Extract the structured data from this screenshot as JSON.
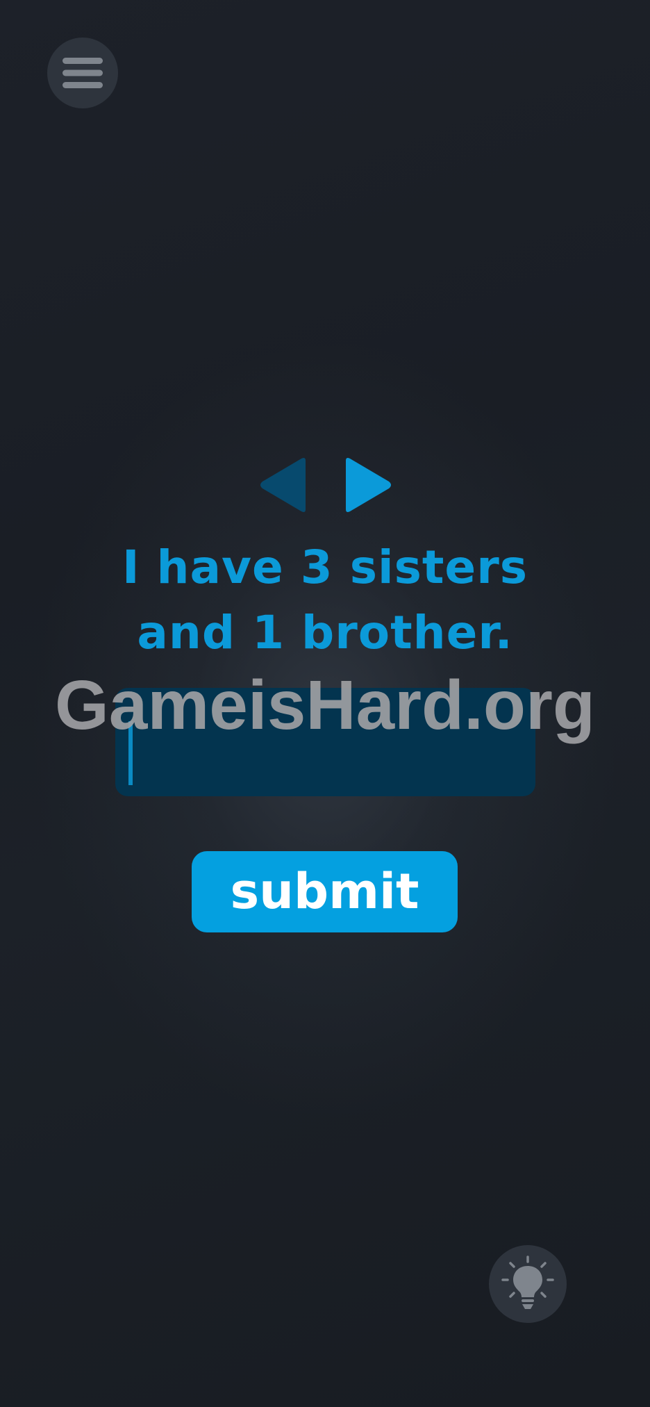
{
  "header": {
    "menu_icon": "hamburger-menu-icon"
  },
  "navigation": {
    "prev_icon": "triangle-left-icon",
    "next_icon": "triangle-right-icon"
  },
  "question": {
    "line1": "I have 3 sisters",
    "line2": "and 1 brother."
  },
  "answer": {
    "value": "",
    "placeholder": ""
  },
  "submit": {
    "label": "submit"
  },
  "watermark": {
    "text": "GameisHard.org"
  },
  "hint": {
    "icon": "lightbulb-icon"
  },
  "colors": {
    "accent": "#0b9ad9",
    "button": "#04a0e0",
    "input_bg": "#03344f",
    "arrow_disabled": "#074a6e",
    "circle_button_bg": "#2e343d",
    "icon_gray": "#7f858d"
  }
}
